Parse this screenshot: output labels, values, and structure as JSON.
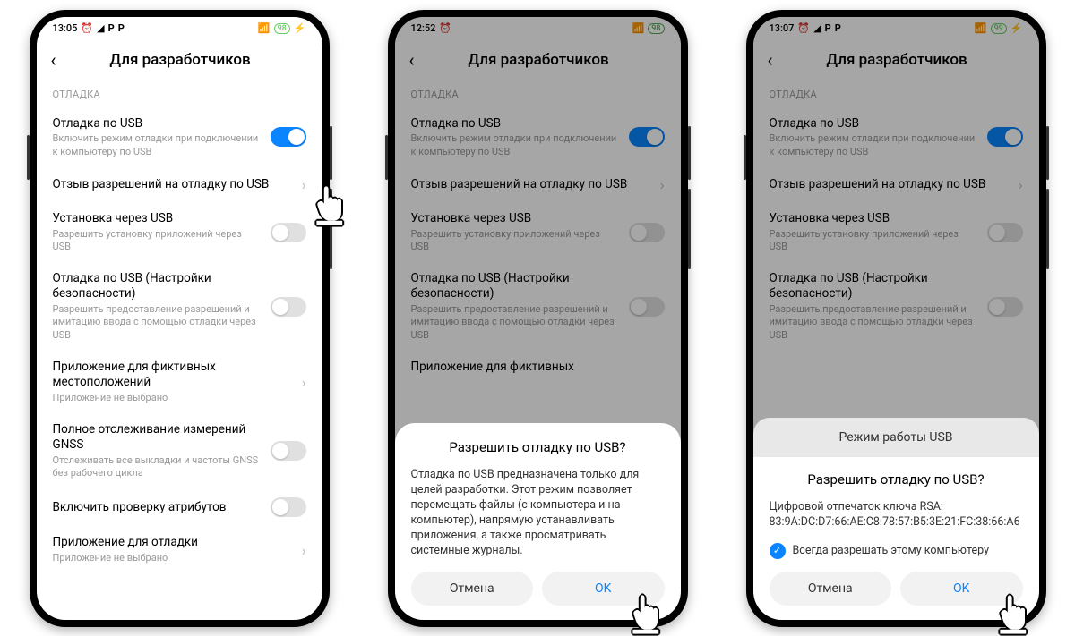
{
  "screens": [
    {
      "status": {
        "time": "13:05",
        "battery": "98"
      },
      "header": {
        "title": "Для разработчиков"
      },
      "section": "ОТЛАДКА",
      "items": {
        "usb_debug": {
          "title": "Отладка по USB",
          "sub": "Включить режим отладки при подключении к компьютеру по USB"
        },
        "revoke": {
          "title": "Отзыв разрешений на отладку по USB"
        },
        "install_usb": {
          "title": "Установка через USB",
          "sub": "Разрешить установку приложений через USB"
        },
        "usb_sec": {
          "title": "Отладка по USB (Настройки безопасности)",
          "sub": "Разрешить предоставление разрешений и имитацию ввода с помощью отладки через USB"
        },
        "mock_loc": {
          "title": "Приложение для фиктивных местоположений",
          "sub": "Приложение не выбрано"
        },
        "gnss": {
          "title": "Полное отслеживание измерений GNSS",
          "sub": "Отслеживать все выкладки и частоты GNSS без рабочего цикла"
        },
        "attr_check": {
          "title": "Включить проверку атрибутов"
        },
        "debug_app": {
          "title": "Приложение для отладки",
          "sub": "Приложение не выбрано"
        }
      }
    },
    {
      "status": {
        "time": "12:52",
        "battery": "98"
      },
      "header": {
        "title": "Для разработчиков"
      },
      "section": "ОТЛАДКА",
      "items": {
        "usb_debug": {
          "title": "Отладка по USB",
          "sub": "Включить режим отладки при подключении к компьютеру по USB"
        },
        "revoke": {
          "title": "Отзыв разрешений на отладку по USB"
        },
        "install_usb": {
          "title": "Установка через USB",
          "sub": "Разрешить установку приложений через USB"
        },
        "usb_sec": {
          "title": "Отладка по USB (Настройки безопасности)",
          "sub": "Разрешить предоставление разрешений и имитацию ввода с помощью отладки через USB"
        },
        "mock_loc": {
          "title": "Приложение для фиктивных"
        }
      },
      "dialog": {
        "title": "Разрешить отладку по USB?",
        "body": "Отладка по USB предназначена только для целей разработки. Этот режим позволяет перемещать файлы (с компьютера и на компьютер), напрямую устанавливать приложения, а также просматривать системные журналы.",
        "cancel": "Отмена",
        "ok": "OK"
      }
    },
    {
      "status": {
        "time": "13:07",
        "battery": "99"
      },
      "header": {
        "title": "Для разработчиков"
      },
      "section": "ОТЛАДКА",
      "items": {
        "usb_debug": {
          "title": "Отладка по USB",
          "sub": "Включить режим отладки при подключении к компьютеру по USB"
        },
        "revoke": {
          "title": "Отзыв разрешений на отладку по USB"
        },
        "install_usb": {
          "title": "Установка через USB",
          "sub": "Разрешить установку приложений через USB"
        },
        "usb_sec": {
          "title": "Отладка по USB (Настройки безопасности)",
          "sub": "Разрешить предоставление разрешений и имитацию ввода с помощью отладки через USB"
        }
      },
      "dialog": {
        "header_strip": "Режим работы USB",
        "title": "Разрешить отладку по USB?",
        "body_label": "Цифровой отпечаток ключа RSA:",
        "body_value": "83:9A:DC:D7:66:AE:C8:78:57:B5:3E:21:FC:38:66:A6",
        "check": "Всегда разрешать этому компьютеру",
        "cancel": "Отмена",
        "ok": "OK"
      }
    }
  ]
}
